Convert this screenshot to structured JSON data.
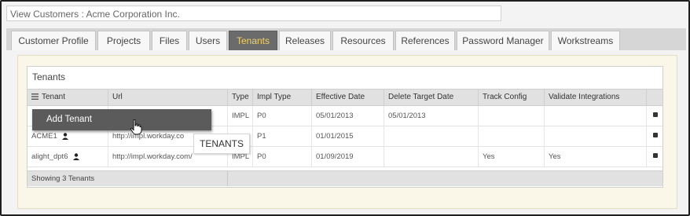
{
  "window": {
    "title": "View Customers : Acme Corporation Inc."
  },
  "tabs": [
    {
      "label": "Customer Profile"
    },
    {
      "label": "Projects"
    },
    {
      "label": "Files"
    },
    {
      "label": "Users"
    },
    {
      "label": "Tenants",
      "active": true
    },
    {
      "label": "Releases"
    },
    {
      "label": "Resources"
    },
    {
      "label": "References"
    },
    {
      "label": "Password Manager"
    },
    {
      "label": "Workstreams"
    }
  ],
  "tenants": {
    "title": "Tenants",
    "columns": [
      "Tenant",
      "Url",
      "Type",
      "Impl Type",
      "Effective Date",
      "Delete Target Date",
      "Track Config",
      "Validate Integrations"
    ],
    "rows": [
      {
        "tenant": "",
        "url": "",
        "type": "IMPL",
        "impl_type": "P0",
        "effective_date": "05/01/2013",
        "delete_target_date": "05/01/2013",
        "track_config": "",
        "validate_integrations": ""
      },
      {
        "tenant": "ACME1",
        "url": "http://impl.workday.co",
        "type": "",
        "impl_type": "P1",
        "effective_date": "01/01/2015",
        "delete_target_date": "",
        "track_config": "",
        "validate_integrations": ""
      },
      {
        "tenant": "alight_dpt6",
        "url": "http://impl.workday.com/",
        "type": "IMPL",
        "impl_type": "P0",
        "effective_date": "01/09/2019",
        "delete_target_date": "",
        "track_config": "Yes",
        "validate_integrations": "Yes"
      }
    ],
    "footer": "Showing 3 Tenants"
  },
  "context_menu": {
    "item": "Add Tenant"
  },
  "tooltip": {
    "text": "TENANTS"
  },
  "colors": {
    "active_tab_bg": "#6b6b6b",
    "active_tab_text": "#f2d264",
    "panel_bg": "#fbf7e8",
    "menu_bg": "#5b5b5b"
  },
  "icons": {
    "column_menu": "hamburger-icon",
    "user": "user-icon",
    "row_action": "square-icon",
    "cursor": "hand-pointer-icon"
  }
}
